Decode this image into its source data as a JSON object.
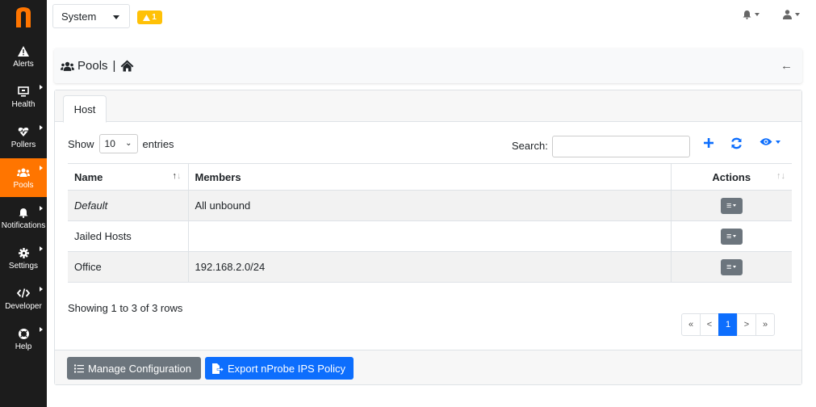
{
  "sidebar": {
    "logo_letter": "n",
    "items": [
      {
        "label": "Alerts",
        "icon": "warning-icon"
      },
      {
        "label": "Health",
        "icon": "monitor-icon"
      },
      {
        "label": "Pollers",
        "icon": "heartbeat-icon"
      },
      {
        "label": "Pools",
        "icon": "users-icon"
      },
      {
        "label": "Notifications",
        "icon": "bell-icon"
      },
      {
        "label": "Settings",
        "icon": "gear-icon"
      },
      {
        "label": "Developer",
        "icon": "code-icon"
      },
      {
        "label": "Help",
        "icon": "life-ring-icon"
      }
    ],
    "active": "Pools",
    "active_color": "#ff7500"
  },
  "topbar": {
    "interface_selected": "System",
    "alert_count": "1"
  },
  "breadcrumb": {
    "title": "Pools",
    "separator": "|"
  },
  "tabs": [
    {
      "label": "Host"
    }
  ],
  "table_controls": {
    "show_label": "Show",
    "entries_value": "10",
    "entries_label": "entries",
    "search_label": "Search:",
    "search_value": ""
  },
  "table": {
    "columns": [
      "Name",
      "Members",
      "Actions"
    ],
    "rows": [
      {
        "name": "Default",
        "members": "All unbound"
      },
      {
        "name": "Jailed Hosts",
        "members": ""
      },
      {
        "name": "Office",
        "members": "192.168.2.0/24"
      }
    ]
  },
  "summary": "Showing 1 to 3 of 3 rows",
  "pagination": {
    "first": "«",
    "prev": "<",
    "current": "1",
    "next": ">",
    "last": "»"
  },
  "footer": {
    "manage_label": "Manage Configuration",
    "export_label": "Export nProbe IPS Policy"
  },
  "colors": {
    "accent": "#0d6efd",
    "warning": "#ffc107",
    "sidebar_bg": "#1c1c1c"
  }
}
